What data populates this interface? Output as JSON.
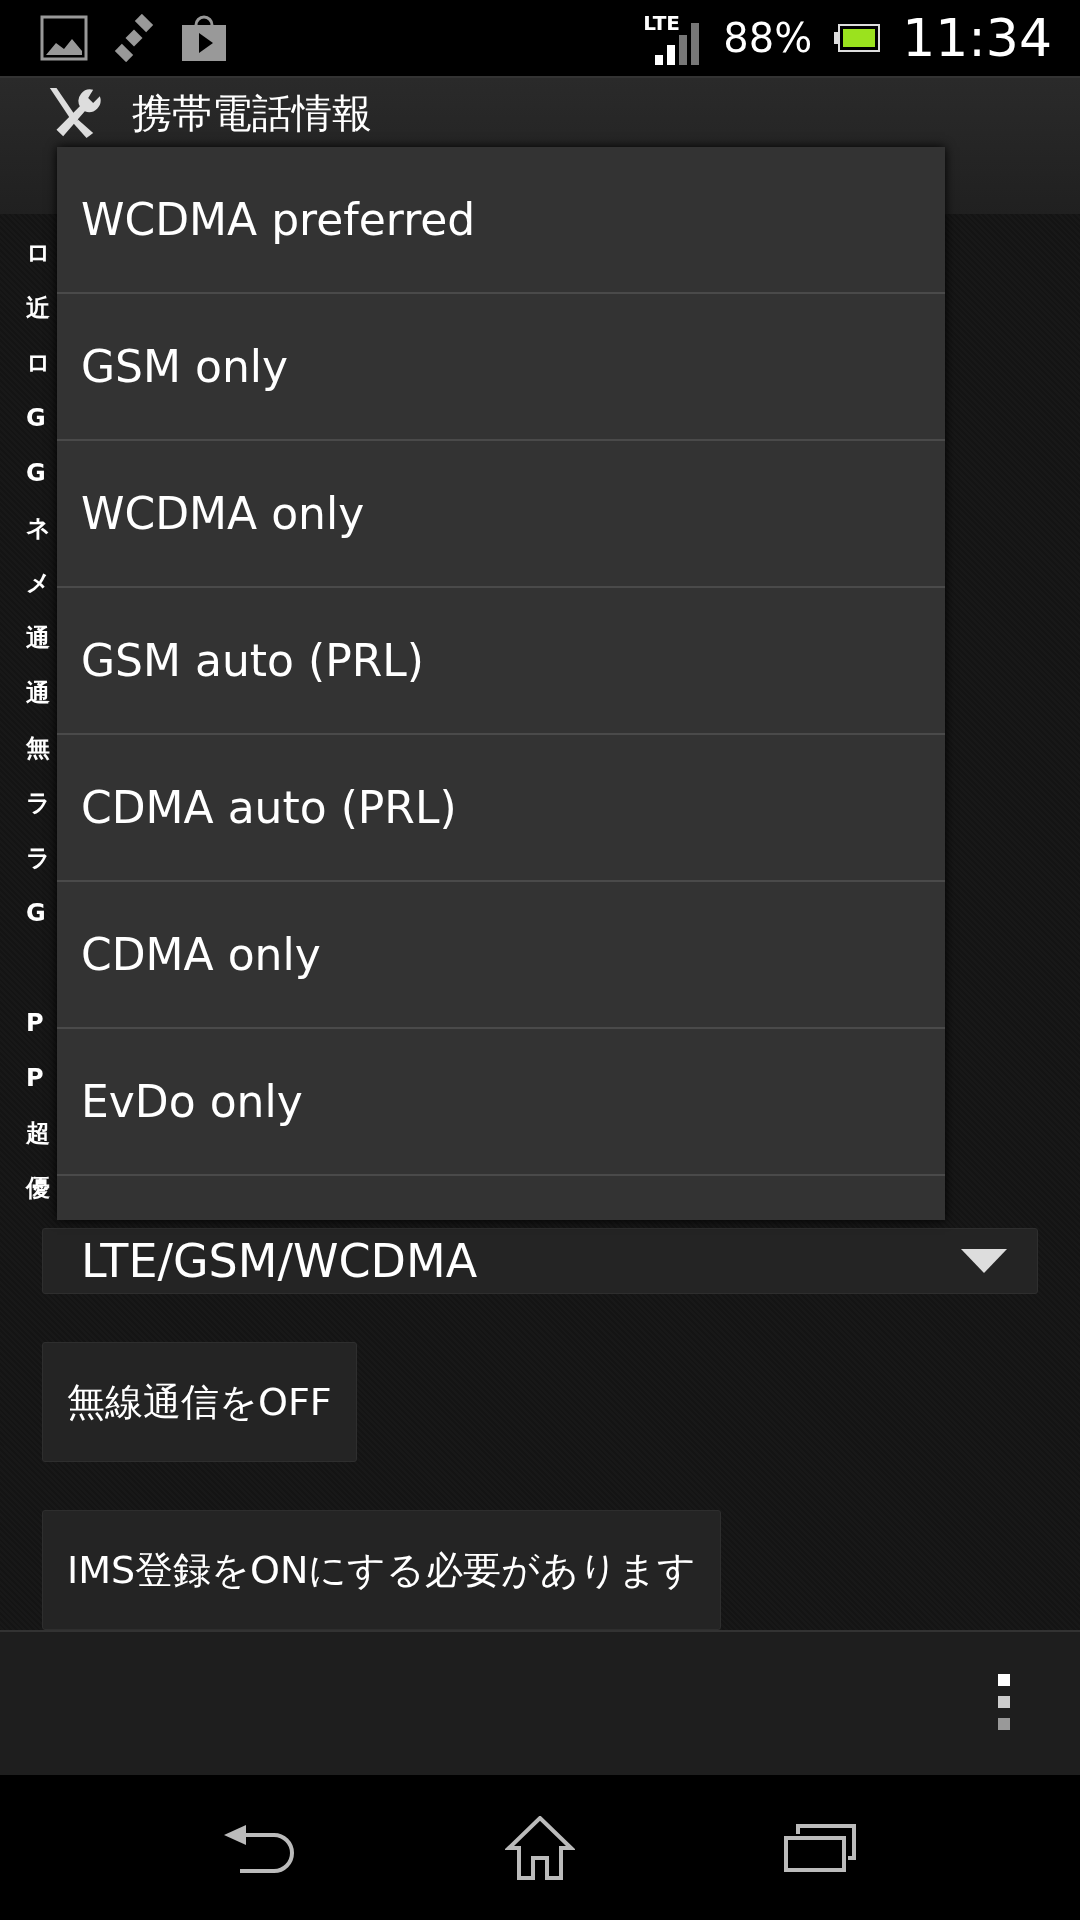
{
  "status_bar": {
    "network": "LTE",
    "battery": "88%",
    "time": "11:34"
  },
  "action_bar": {
    "title": "携帯電話情報"
  },
  "info_lines": [
    "ロ",
    "近",
    "ロ",
    "G",
    "G",
    "ネ",
    "メ",
    "通",
    "通",
    "無",
    "ラ",
    "ラ",
    "G",
    "P",
    "P",
    "超",
    "優"
  ],
  "network_spinner": {
    "value": "LTE/GSM/WCDMA"
  },
  "buttons": [
    "無線通信をOFF",
    "IMS登録をONにする必要があります"
  ],
  "dropdown_menu": {
    "items": [
      "WCDMA preferred",
      "GSM only",
      "WCDMA only",
      "GSM auto (PRL)",
      "CDMA auto (PRL)",
      "CDMA only",
      "EvDo only"
    ]
  }
}
